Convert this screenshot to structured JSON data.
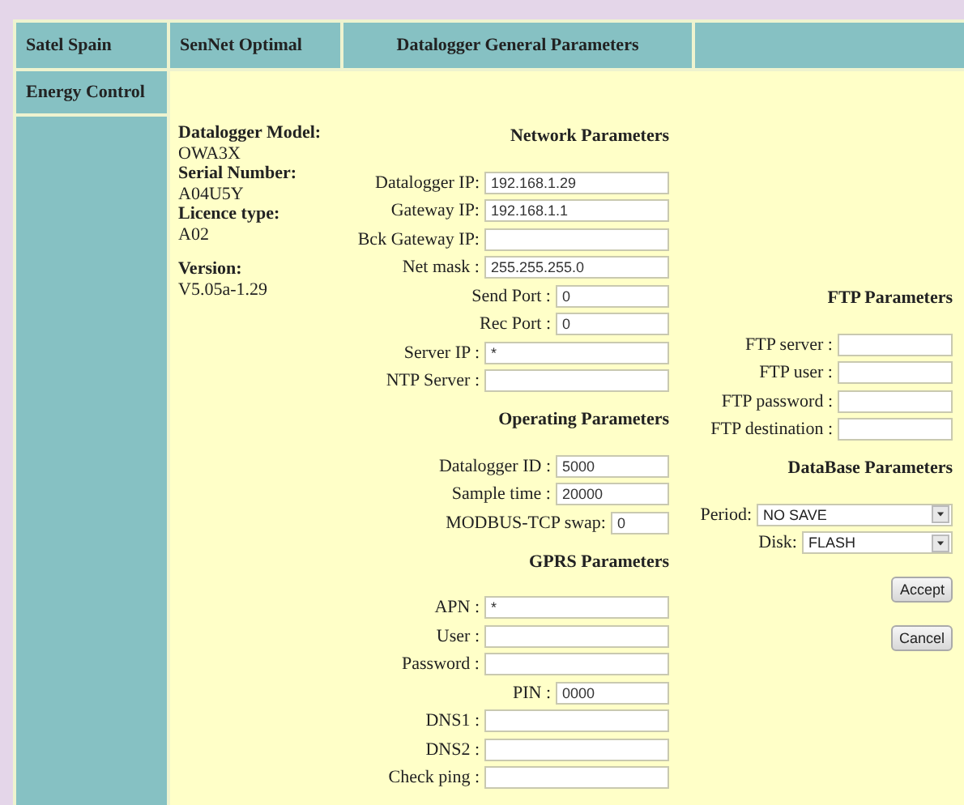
{
  "header": [
    "Satel Spain",
    "SenNet Optimal",
    "Datalogger General Parameters"
  ],
  "sidebar": {
    "items": [
      "Energy Control"
    ]
  },
  "info": [
    {
      "label": "Datalogger Model:",
      "value": "OWA3X"
    },
    {
      "label": "Serial Number:",
      "value": "A04U5Y"
    },
    {
      "label": "Licence type:",
      "value": "A02"
    },
    {
      "label": "Version:",
      "value": "V5.05a-1.29"
    }
  ],
  "center_sections": [
    {
      "title": "Network Parameters",
      "fields": [
        {
          "label": "Datalogger IP:",
          "value": "192.168.1.29"
        },
        {
          "label": "Gateway IP:",
          "value": "192.168.1.1"
        },
        {
          "label": "Bck Gateway IP:"
        },
        {
          "label": "Net mask :",
          "value": "255.255.255.0"
        },
        {
          "label": "Send Port :",
          "value": "0",
          "kind": "short"
        },
        {
          "label": "Rec Port :",
          "value": "0",
          "kind": "short"
        },
        {
          "label": "Server IP :",
          "value": "*"
        },
        {
          "label": "NTP Server :"
        }
      ]
    },
    {
      "title": "Operating Parameters",
      "fields": [
        {
          "label": "Datalogger ID :",
          "value": "5000",
          "kind": "short"
        },
        {
          "label": "Sample time :",
          "value": "20000",
          "kind": "short"
        },
        {
          "label": "MODBUS-TCP swap:",
          "value": "0",
          "kind": "tiny"
        }
      ]
    },
    {
      "title": "GPRS Parameters",
      "fields": [
        {
          "label": "APN :",
          "value": "*"
        },
        {
          "label": "User :"
        },
        {
          "label": "Password :"
        },
        {
          "label": "PIN :",
          "value": "0000",
          "kind": "short"
        },
        {
          "label": "DNS1 :"
        },
        {
          "label": "DNS2 :"
        },
        {
          "label": "Check ping :"
        }
      ]
    }
  ],
  "ftp": {
    "title": "FTP Parameters",
    "fields": [
      {
        "label": "FTP server :"
      },
      {
        "label": "FTP user :"
      },
      {
        "label": "FTP password :"
      },
      {
        "label": "FTP destination :"
      }
    ]
  },
  "database": {
    "title": "DataBase Parameters",
    "selects": [
      {
        "label": "Period:",
        "value": "NO SAVE"
      },
      {
        "label": "Disk:",
        "value": "FLASH"
      }
    ]
  },
  "buttons": [
    "Accept",
    "Cancel"
  ]
}
